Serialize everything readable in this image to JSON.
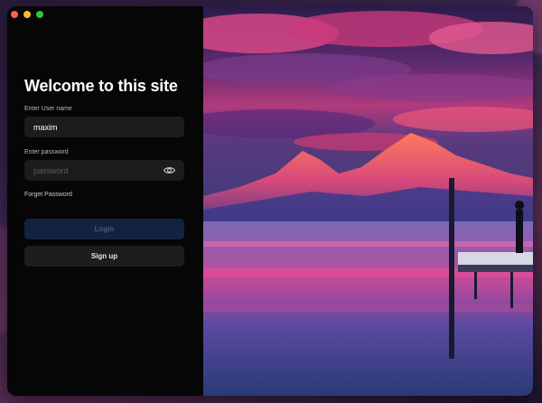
{
  "window": {
    "title": "Welcome to this site"
  },
  "login_form": {
    "username_label": "Enter User name",
    "username_value": "maxim",
    "password_label": "Enter password",
    "password_placeholder": "password",
    "forgot_password": "Forget Password",
    "login_button": "Login",
    "signup_button": "Sign up"
  },
  "icons": {
    "password_toggle": "eye-icon"
  },
  "colors": {
    "panel_bg": "#060606",
    "input_bg": "#1c1c1e",
    "login_button_bg": "#12233f",
    "signup_button_bg": "#1d1d1f"
  }
}
